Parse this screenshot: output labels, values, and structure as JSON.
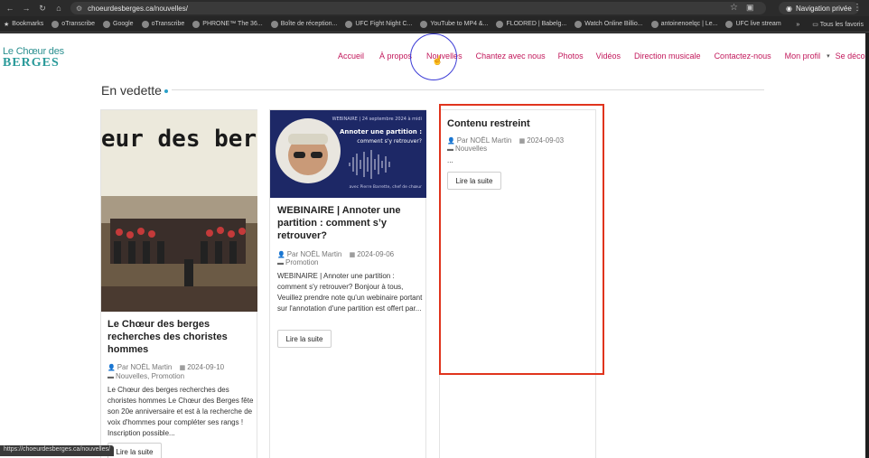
{
  "browser": {
    "url": "choeurdesberges.ca/nouvelles/",
    "private_label": "Navigation privée",
    "bookmarks": [
      "Bookmarks",
      "oTranscribe",
      "Google",
      "oTranscribe",
      "PHRONE™ The 36...",
      "Boîte de réception...",
      "UFC Fight Night C...",
      "YouTube to MP4 &...",
      "FLODRED | Babelg...",
      "Watch Online Billio...",
      "antoinenoelqc | Le...",
      "UFC live stream"
    ],
    "all_bookmarks_label": "Tous les favoris",
    "status_url": "https://choeurdesberges.ca/nouvelles/"
  },
  "site": {
    "logo_line1": "Le Chœur des",
    "logo_line2": "BERGES",
    "menu": [
      "Accueil",
      "À propos",
      "Nouvelles",
      "Chantez avec nous",
      "Photos",
      "Vidéos",
      "Direction musicale",
      "Contactez-nous",
      "Mon profil",
      "Se déconnecter"
    ]
  },
  "section": {
    "title": "En vedette"
  },
  "posts": [
    {
      "image_text": "Choeur des berges",
      "title": "Le Chœur des berges recherches des choristes hommes",
      "author": "Par NOËL Martin",
      "date": "2024-09-10",
      "categories": "Nouvelles, Promotion",
      "excerpt": "Le Chœur des berges recherches des choristes hommes Le Chœur des Berges fête son 20e anniversaire et est à la recherche de voix d'hommes pour compléter ses rangs ! Inscription possible...",
      "read_more": "Lire la suite"
    },
    {
      "image_header": "WEBINAIRE | 24 septembre 2024 à midi",
      "image_title": "Annoter une partition : comment s'y retrouver?",
      "image_footer": "avec Pierre Barrette, chef de chœur",
      "title": "WEBINAIRE | Annoter une partition : comment s’y retrouver?",
      "author": "Par NOËL Martin",
      "date": "2024-09-06",
      "categories": "Promotion",
      "excerpt": "WEBINAIRE | Annoter une partition : comment s'y retrouver? Bonjour à tous, Veuillez prendre note qu'un webinaire portant sur l'annotation d'une partition est offert par...",
      "read_more": "Lire la suite"
    },
    {
      "title": "Contenu restreint",
      "author": "Par NOËL Martin",
      "date": "2024-09-03",
      "categories": "Nouvelles",
      "excerpt": "...",
      "read_more": "Lire la suite"
    }
  ],
  "colors": {
    "menu": "#c2185b",
    "highlight": "#e0341d",
    "logo": "#2a9a9a"
  }
}
